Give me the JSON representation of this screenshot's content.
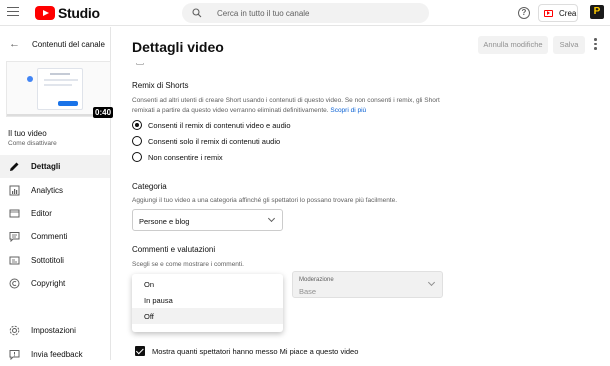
{
  "topbar": {
    "logo_text": "Studio",
    "search_placeholder": "Cerca in tutto il tuo canale",
    "help_label": "?",
    "create_label": "Crea",
    "avatar_letter": "P"
  },
  "sidebar": {
    "back_label": "Contenuti del canale",
    "duration": "0:40",
    "video_title": "Il tuo video",
    "video_sub": "Come disattivare",
    "items": [
      {
        "label": "Dettagli",
        "icon": "pencil-icon",
        "active": true
      },
      {
        "label": "Analytics",
        "icon": "analytics-icon",
        "active": false
      },
      {
        "label": "Editor",
        "icon": "editor-icon",
        "active": false
      },
      {
        "label": "Commenti",
        "icon": "comments-icon",
        "active": false
      },
      {
        "label": "Sottotitoli",
        "icon": "subtitles-icon",
        "active": false
      },
      {
        "label": "Copyright",
        "icon": "copyright-icon",
        "active": false
      },
      {
        "label": "Impostazioni",
        "icon": "settings-icon",
        "active": false
      },
      {
        "label": "Invia feedback",
        "icon": "feedback-icon",
        "active": false
      }
    ]
  },
  "header": {
    "title": "Dettagli video",
    "undo_label": "Annulla modifiche",
    "save_label": "Salva"
  },
  "remix": {
    "title": "Remix di Shorts",
    "desc_line1": "Consenti ad altri utenti di creare Short usando i contenuti di questo video. Se non consenti i remix, gli Short",
    "desc_line2": "remixati a partire da questo video verranno eliminati definitivamente.",
    "learn_more": "Scopri di più",
    "options": [
      {
        "label": "Consenti il remix di contenuti video e audio",
        "checked": true
      },
      {
        "label": "Consenti solo il remix di contenuti audio",
        "checked": false
      },
      {
        "label": "Non consentire i remix",
        "checked": false
      }
    ]
  },
  "category": {
    "title": "Categoria",
    "desc": "Aggiungi il tuo video a una categoria affinché gli spettatori lo possano trovare più facilmente.",
    "value": "Persone e blog"
  },
  "comments": {
    "title": "Commenti e valutazioni",
    "desc": "Scegli se e come mostrare i commenti.",
    "dropdown_options": [
      "On",
      "In pausa",
      "Off"
    ],
    "selected": "Off",
    "moderation_label": "Moderazione",
    "moderation_value": "Base",
    "likes_checkbox": "Mostra quanti spettatori hanno messo Mi piace a questo video"
  }
}
